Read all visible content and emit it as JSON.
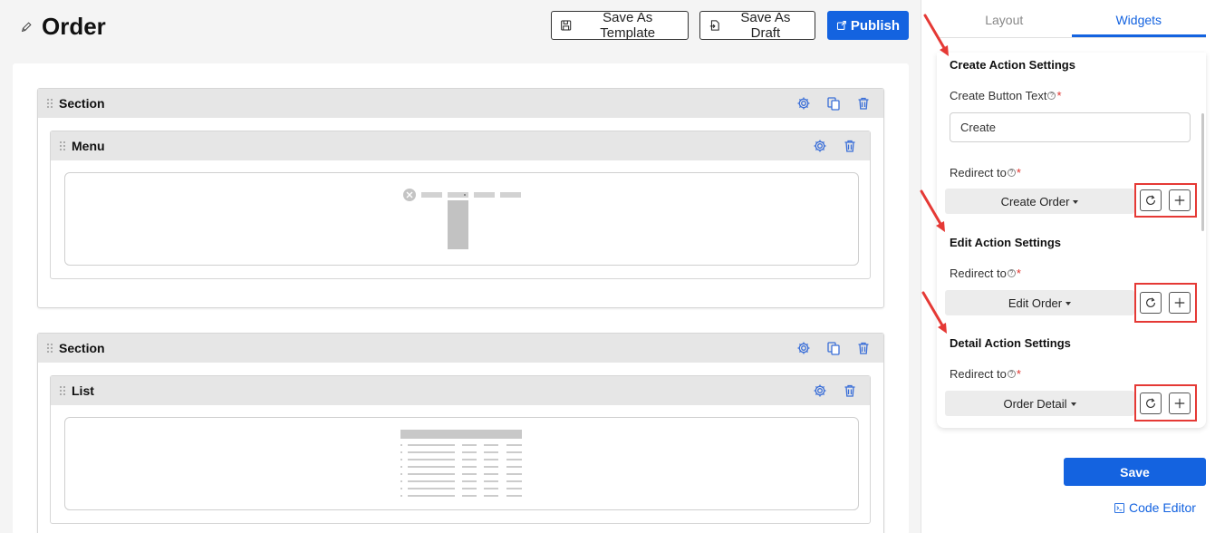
{
  "header": {
    "title": "Order",
    "save_template_label": "Save As Template",
    "save_draft_label": "Save As Draft",
    "publish_label": "Publish"
  },
  "canvas": {
    "sections": [
      {
        "label": "Section",
        "widget_label": "Menu"
      },
      {
        "label": "Section",
        "widget_label": "List"
      }
    ]
  },
  "panel": {
    "tabs": [
      {
        "label": "Layout",
        "active": false
      },
      {
        "label": "Widgets",
        "active": true
      }
    ],
    "create_action": {
      "title": "Create Action Settings",
      "button_text_label": "Create Button Text",
      "button_text_value": "Create",
      "redirect_label": "Redirect to",
      "redirect_value": "Create Order"
    },
    "edit_action": {
      "title": "Edit Action Settings",
      "redirect_label": "Redirect to",
      "redirect_value": "Edit Order"
    },
    "detail_action": {
      "title": "Detail Action Settings",
      "redirect_label": "Redirect to",
      "redirect_value": "Order Detail"
    },
    "save_label": "Save",
    "code_editor_label": "Code Editor"
  },
  "colors": {
    "primary": "#1463e0",
    "highlight": "#e53935",
    "required": "#e0302b"
  }
}
